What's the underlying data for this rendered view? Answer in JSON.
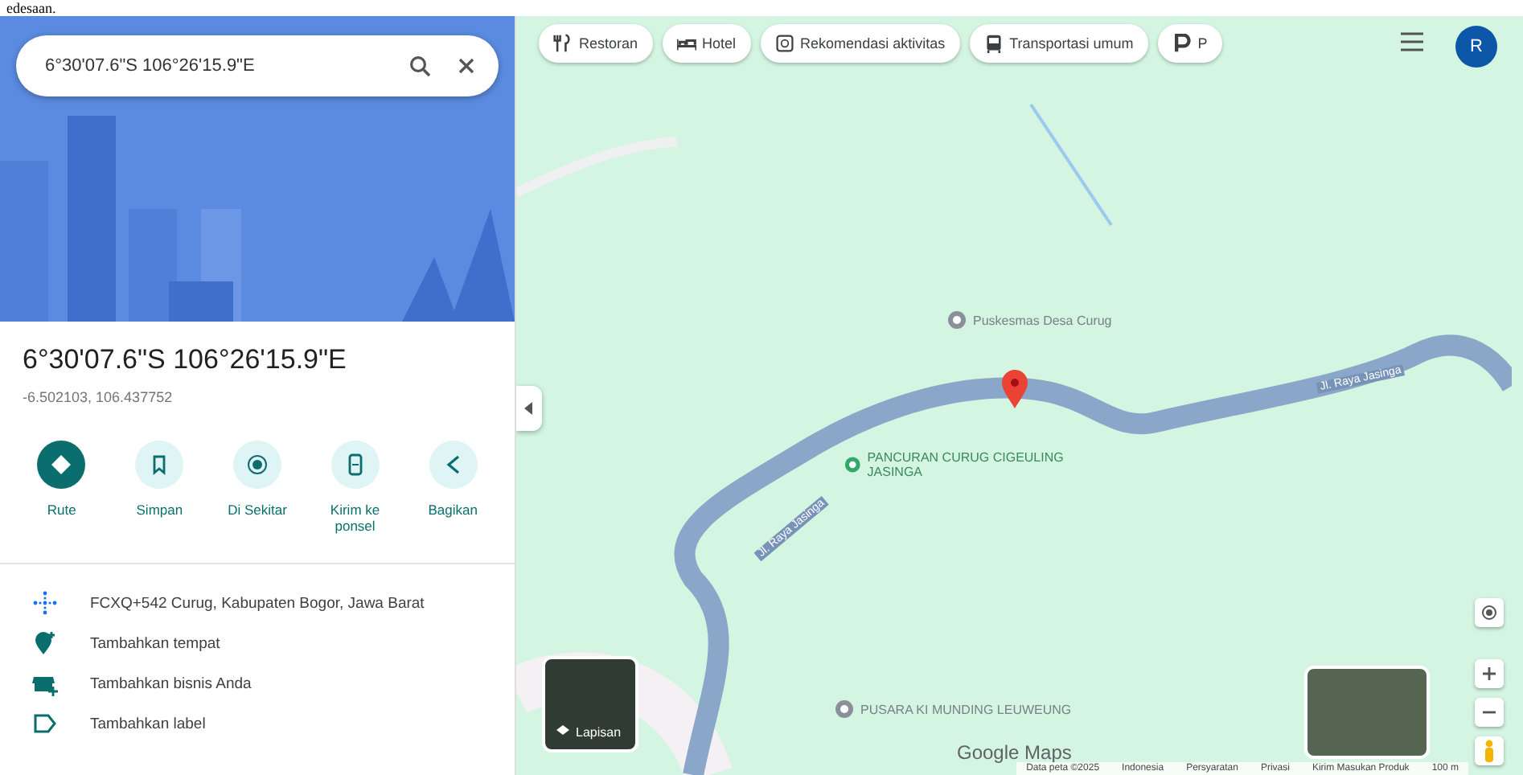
{
  "page_fragment": "edesaan.",
  "search": {
    "value": "6°30'07.6\"S 106°26'15.9\"E"
  },
  "place": {
    "title": "6°30'07.6\"S 106°26'15.9\"E",
    "subtitle": "-6.502103, 106.437752"
  },
  "actions": [
    {
      "label": "Rute",
      "kind": "route"
    },
    {
      "label": "Simpan",
      "kind": "save"
    },
    {
      "label": "Di Sekitar",
      "kind": "nearby"
    },
    {
      "label": "Kirim ke ponsel",
      "kind": "phone"
    },
    {
      "label": "Bagikan",
      "kind": "share"
    }
  ],
  "info_rows": [
    {
      "text": "FCXQ+542 Curug, Kabupaten Bogor, Jawa Barat",
      "kind": "pluscode"
    },
    {
      "text": "Tambahkan tempat",
      "kind": "addplace"
    },
    {
      "text": "Tambahkan bisnis Anda",
      "kind": "business"
    },
    {
      "text": "Tambahkan label",
      "kind": "label"
    }
  ],
  "chips": [
    {
      "label": "Restoran",
      "kind": "restaurant"
    },
    {
      "label": "Hotel",
      "kind": "hotel"
    },
    {
      "label": "Rekomendasi aktivitas",
      "kind": "activity"
    },
    {
      "label": "Transportasi umum",
      "kind": "transit"
    },
    {
      "label": "P",
      "kind": "parking"
    }
  ],
  "account": {
    "initial": "R"
  },
  "map_labels": [
    {
      "text": "Puskesmas Desa Curug",
      "kind": "health"
    },
    {
      "text": "PANCURAN CURUG CIGEULING JASINGA",
      "kind": "park"
    },
    {
      "text": "PUSARA KI MUNDING LEUWEUNG",
      "kind": "place"
    }
  ],
  "road_labels": [
    "Jl. Raya Jasinga",
    "Jl. Raya Jasinga"
  ],
  "layers": {
    "label": "Lapisan"
  },
  "brand": "Google Maps",
  "footer": [
    "Data peta ©2025",
    "Indonesia",
    "Persyaratan",
    "Privasi",
    "Kirim Masukan Produk",
    "100 m"
  ]
}
